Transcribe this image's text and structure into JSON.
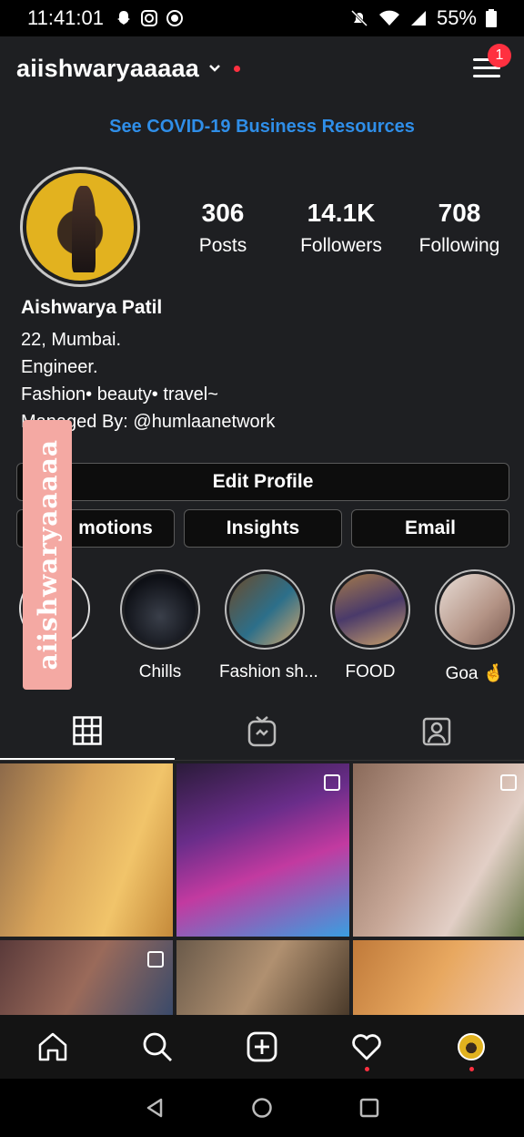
{
  "status_bar": {
    "time": "11:41:01",
    "battery": "55%"
  },
  "header": {
    "username": "aiishwaryaaaaa",
    "notification_count": "1"
  },
  "covid_link": "See COVID-19 Business Resources",
  "stats": [
    {
      "value": "306",
      "label": "Posts"
    },
    {
      "value": "14.1K",
      "label": "Followers"
    },
    {
      "value": "708",
      "label": "Following"
    }
  ],
  "bio": {
    "name": "Aishwarya  Patil",
    "lines": [
      "22, Mumbai.",
      "Engineer.",
      "Fashion•  beauty• travel~",
      "Managed By: @humlaanetwork"
    ]
  },
  "overlay_tag": "aiishwaryaaaaa",
  "buttons": {
    "edit_profile": "Edit Profile",
    "promotions": "motions",
    "insights": "Insights",
    "email": "Email"
  },
  "highlights": [
    {
      "label": "Chills"
    },
    {
      "label": "Fashion sh..."
    },
    {
      "label": "FOOD"
    },
    {
      "label": "Goa 🤞"
    }
  ],
  "colors": {
    "accent_link": "#2f8ee8",
    "notification": "#ff3040",
    "overlay_tag": "#f4a9a3",
    "background": "#1e1f22"
  }
}
